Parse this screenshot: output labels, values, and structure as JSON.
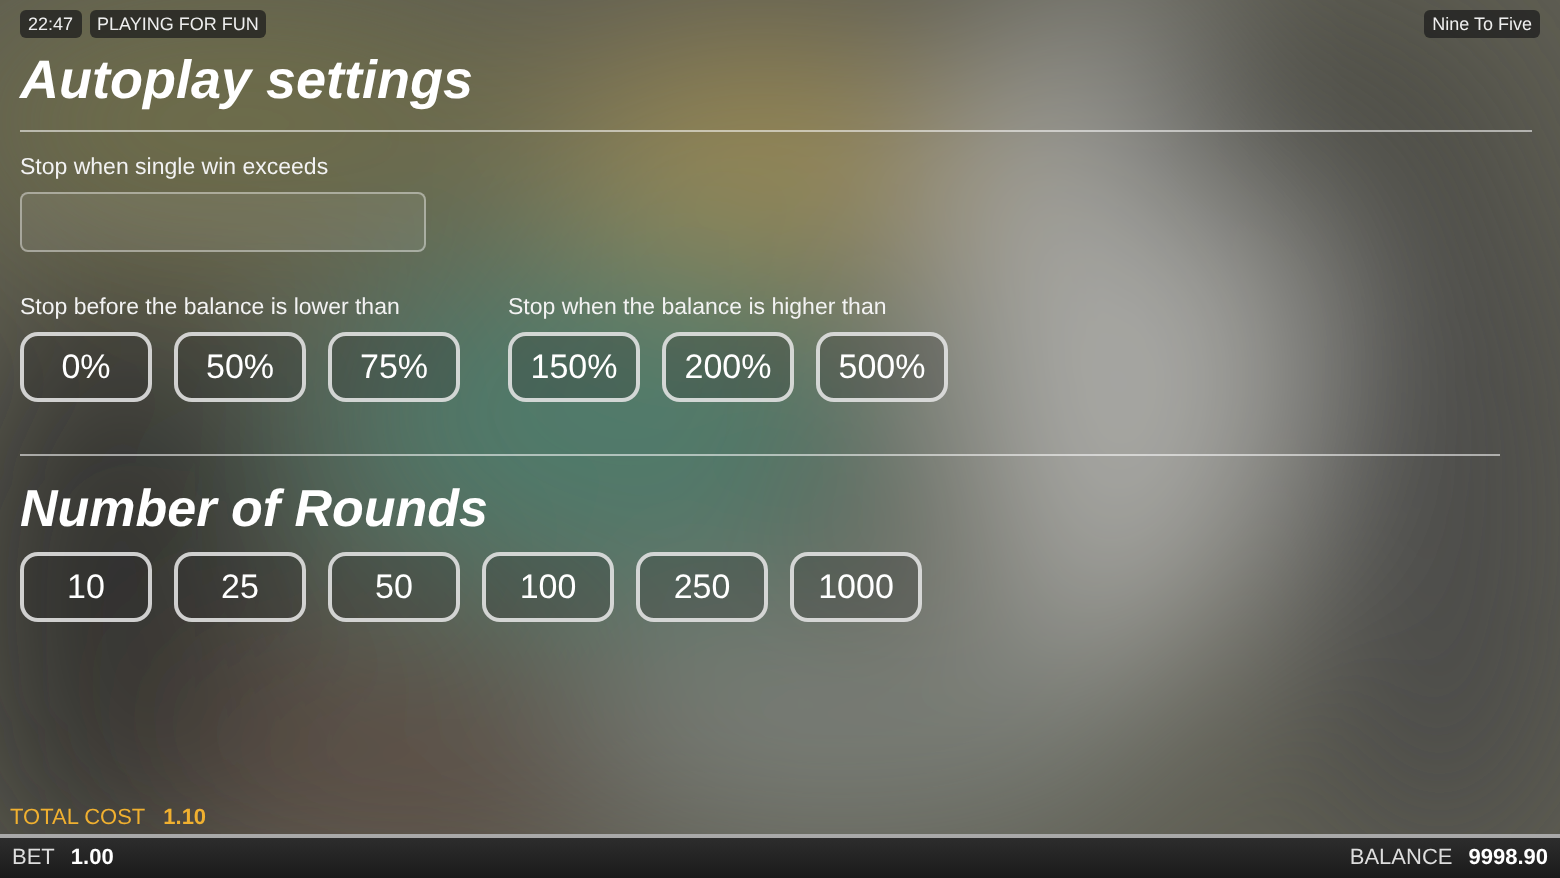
{
  "status": {
    "time": "22:47",
    "mode": "PLAYING FOR FUN",
    "game": "Nine To Five"
  },
  "title": "Autoplay settings",
  "single_win": {
    "label": "Stop when single win exceeds"
  },
  "loss_limit": {
    "label": "Stop before the balance is lower than",
    "options": [
      {
        "label": "0%",
        "selected": false
      },
      {
        "label": "50%",
        "selected": false
      },
      {
        "label": "75%",
        "selected": false
      }
    ]
  },
  "win_limit": {
    "label": "Stop when the balance is higher than",
    "options": [
      {
        "label": "150%",
        "selected": false
      },
      {
        "label": "200%",
        "selected": false
      },
      {
        "label": "500%",
        "selected": false
      }
    ]
  },
  "rounds": {
    "title": "Number of Rounds",
    "options": [
      {
        "label": "10",
        "selected": false
      },
      {
        "label": "25",
        "selected": false
      },
      {
        "label": "50",
        "selected": false
      },
      {
        "label": "100",
        "selected": false
      },
      {
        "label": "250",
        "selected": false
      },
      {
        "label": "1000",
        "selected": false
      }
    ]
  },
  "total_cost": {
    "label": "TOTAL COST",
    "value": "1.10"
  },
  "footer": {
    "bet_label": "BET",
    "bet": "1.00",
    "balance_label": "BALANCE",
    "balance": "9998.90"
  }
}
